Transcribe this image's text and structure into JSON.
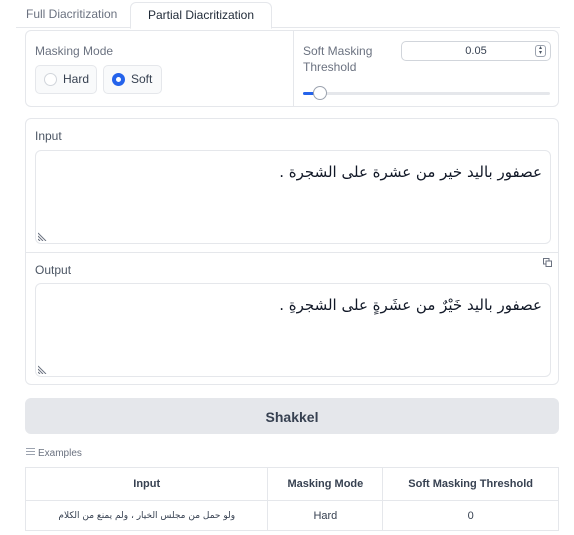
{
  "tabs": [
    {
      "label": "Full Diacritization",
      "active": false
    },
    {
      "label": "Partial Diacritization",
      "active": true
    }
  ],
  "settings": {
    "masking_mode_label": "Masking Mode",
    "options": [
      {
        "label": "Hard",
        "selected": false
      },
      {
        "label": "Soft",
        "selected": true
      }
    ],
    "threshold_label": "Soft Masking Threshold",
    "threshold_value": "0.05",
    "slider_fraction": 0.05
  },
  "input": {
    "label": "Input",
    "value": "عصفور باليد خير من عشرة على الشجرة ."
  },
  "output": {
    "label": "Output",
    "value": "عصفور باليد خَيْرٌ من عشَرةٍ على الشجرةِ ."
  },
  "submit_label": "Shakkel",
  "examples": {
    "title": "Examples",
    "headers": [
      "Input",
      "Masking Mode",
      "Soft Masking Threshold"
    ],
    "rows": [
      [
        "ولو حمل من مجلس الخيار ، ولم يمنع من الكلام",
        "Hard",
        "0"
      ]
    ]
  },
  "colors": {
    "accent": "#2563eb",
    "button_bg": "#e5e7eb",
    "border": "#e5e7eb"
  }
}
